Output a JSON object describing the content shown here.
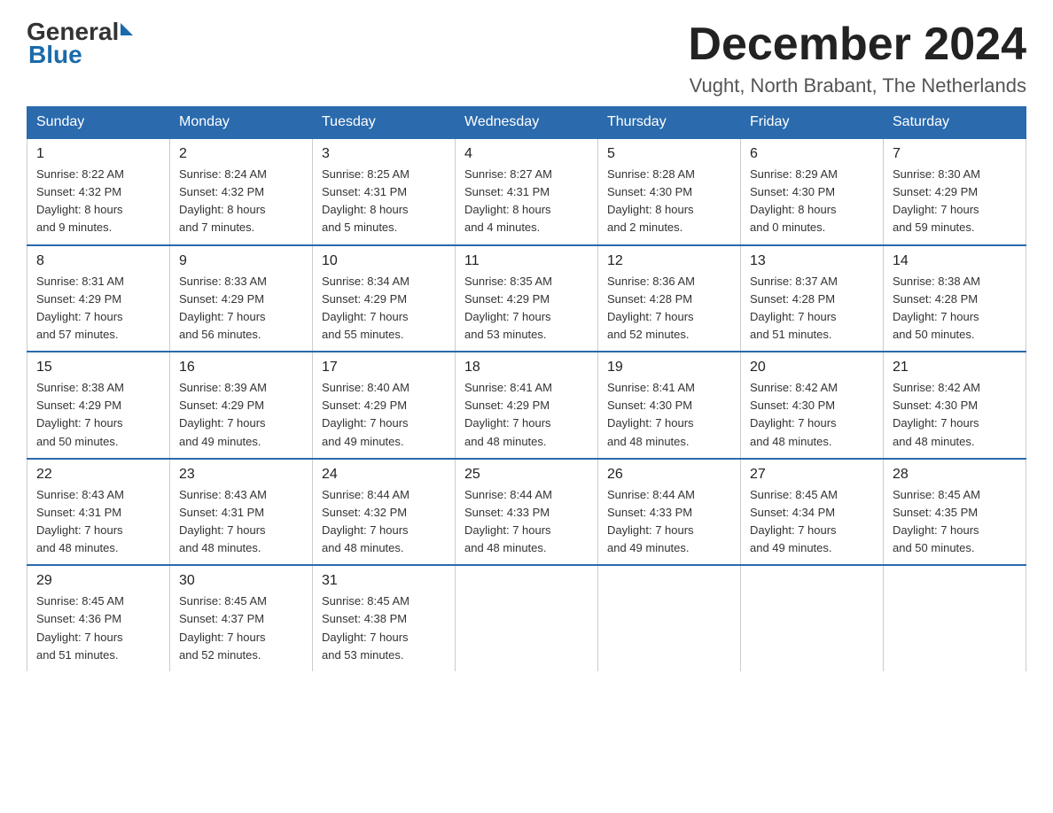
{
  "header": {
    "logo_general": "General",
    "logo_blue": "Blue",
    "month_title": "December 2024",
    "location": "Vught, North Brabant, The Netherlands"
  },
  "days_of_week": [
    "Sunday",
    "Monday",
    "Tuesday",
    "Wednesday",
    "Thursday",
    "Friday",
    "Saturday"
  ],
  "weeks": [
    [
      {
        "day": "1",
        "sunrise": "8:22 AM",
        "sunset": "4:32 PM",
        "daylight": "8 hours and 9 minutes."
      },
      {
        "day": "2",
        "sunrise": "8:24 AM",
        "sunset": "4:32 PM",
        "daylight": "8 hours and 7 minutes."
      },
      {
        "day": "3",
        "sunrise": "8:25 AM",
        "sunset": "4:31 PM",
        "daylight": "8 hours and 5 minutes."
      },
      {
        "day": "4",
        "sunrise": "8:27 AM",
        "sunset": "4:31 PM",
        "daylight": "8 hours and 4 minutes."
      },
      {
        "day": "5",
        "sunrise": "8:28 AM",
        "sunset": "4:30 PM",
        "daylight": "8 hours and 2 minutes."
      },
      {
        "day": "6",
        "sunrise": "8:29 AM",
        "sunset": "4:30 PM",
        "daylight": "8 hours and 0 minutes."
      },
      {
        "day": "7",
        "sunrise": "8:30 AM",
        "sunset": "4:29 PM",
        "daylight": "7 hours and 59 minutes."
      }
    ],
    [
      {
        "day": "8",
        "sunrise": "8:31 AM",
        "sunset": "4:29 PM",
        "daylight": "7 hours and 57 minutes."
      },
      {
        "day": "9",
        "sunrise": "8:33 AM",
        "sunset": "4:29 PM",
        "daylight": "7 hours and 56 minutes."
      },
      {
        "day": "10",
        "sunrise": "8:34 AM",
        "sunset": "4:29 PM",
        "daylight": "7 hours and 55 minutes."
      },
      {
        "day": "11",
        "sunrise": "8:35 AM",
        "sunset": "4:29 PM",
        "daylight": "7 hours and 53 minutes."
      },
      {
        "day": "12",
        "sunrise": "8:36 AM",
        "sunset": "4:28 PM",
        "daylight": "7 hours and 52 minutes."
      },
      {
        "day": "13",
        "sunrise": "8:37 AM",
        "sunset": "4:28 PM",
        "daylight": "7 hours and 51 minutes."
      },
      {
        "day": "14",
        "sunrise": "8:38 AM",
        "sunset": "4:28 PM",
        "daylight": "7 hours and 50 minutes."
      }
    ],
    [
      {
        "day": "15",
        "sunrise": "8:38 AM",
        "sunset": "4:29 PM",
        "daylight": "7 hours and 50 minutes."
      },
      {
        "day": "16",
        "sunrise": "8:39 AM",
        "sunset": "4:29 PM",
        "daylight": "7 hours and 49 minutes."
      },
      {
        "day": "17",
        "sunrise": "8:40 AM",
        "sunset": "4:29 PM",
        "daylight": "7 hours and 49 minutes."
      },
      {
        "day": "18",
        "sunrise": "8:41 AM",
        "sunset": "4:29 PM",
        "daylight": "7 hours and 48 minutes."
      },
      {
        "day": "19",
        "sunrise": "8:41 AM",
        "sunset": "4:30 PM",
        "daylight": "7 hours and 48 minutes."
      },
      {
        "day": "20",
        "sunrise": "8:42 AM",
        "sunset": "4:30 PM",
        "daylight": "7 hours and 48 minutes."
      },
      {
        "day": "21",
        "sunrise": "8:42 AM",
        "sunset": "4:30 PM",
        "daylight": "7 hours and 48 minutes."
      }
    ],
    [
      {
        "day": "22",
        "sunrise": "8:43 AM",
        "sunset": "4:31 PM",
        "daylight": "7 hours and 48 minutes."
      },
      {
        "day": "23",
        "sunrise": "8:43 AM",
        "sunset": "4:31 PM",
        "daylight": "7 hours and 48 minutes."
      },
      {
        "day": "24",
        "sunrise": "8:44 AM",
        "sunset": "4:32 PM",
        "daylight": "7 hours and 48 minutes."
      },
      {
        "day": "25",
        "sunrise": "8:44 AM",
        "sunset": "4:33 PM",
        "daylight": "7 hours and 48 minutes."
      },
      {
        "day": "26",
        "sunrise": "8:44 AM",
        "sunset": "4:33 PM",
        "daylight": "7 hours and 49 minutes."
      },
      {
        "day": "27",
        "sunrise": "8:45 AM",
        "sunset": "4:34 PM",
        "daylight": "7 hours and 49 minutes."
      },
      {
        "day": "28",
        "sunrise": "8:45 AM",
        "sunset": "4:35 PM",
        "daylight": "7 hours and 50 minutes."
      }
    ],
    [
      {
        "day": "29",
        "sunrise": "8:45 AM",
        "sunset": "4:36 PM",
        "daylight": "7 hours and 51 minutes."
      },
      {
        "day": "30",
        "sunrise": "8:45 AM",
        "sunset": "4:37 PM",
        "daylight": "7 hours and 52 minutes."
      },
      {
        "day": "31",
        "sunrise": "8:45 AM",
        "sunset": "4:38 PM",
        "daylight": "7 hours and 53 minutes."
      },
      null,
      null,
      null,
      null
    ]
  ],
  "labels": {
    "sunrise": "Sunrise:",
    "sunset": "Sunset:",
    "daylight": "Daylight:"
  }
}
